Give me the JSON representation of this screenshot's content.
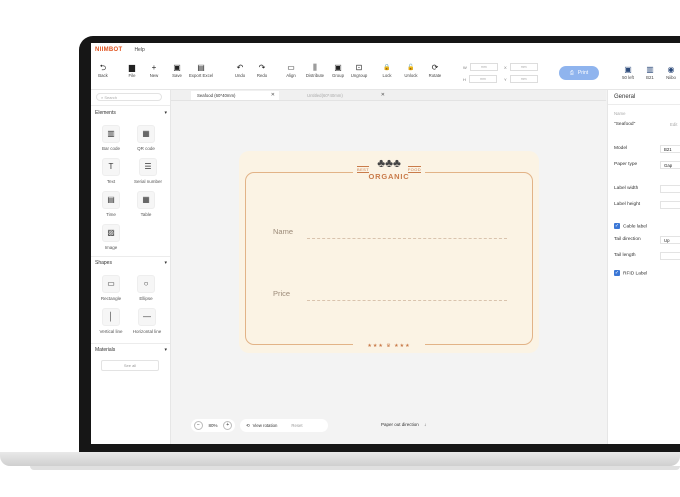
{
  "app": {
    "brand": "NIIMBOT",
    "menu_help": "Help"
  },
  "toolbar": {
    "items": [
      {
        "label": "Back",
        "icon": "back-icon",
        "glyph": "⮌"
      },
      {
        "label": "File",
        "icon": "file-icon",
        "glyph": "▆"
      },
      {
        "label": "New",
        "icon": "plus-icon",
        "glyph": "+"
      },
      {
        "label": "Save",
        "icon": "save-icon",
        "glyph": "▣"
      },
      {
        "label": "Export Excel",
        "icon": "export-excel-icon",
        "glyph": "▤"
      },
      {
        "label": "Undo",
        "icon": "undo-icon",
        "glyph": "↶"
      },
      {
        "label": "Redo",
        "icon": "redo-icon",
        "glyph": "↷"
      },
      {
        "label": "Align",
        "icon": "align-icon",
        "glyph": "▭"
      },
      {
        "label": "Distribute",
        "icon": "distribute-icon",
        "glyph": "⫼"
      },
      {
        "label": "Group",
        "icon": "group-icon",
        "glyph": "▣"
      },
      {
        "label": "Ungroup",
        "icon": "ungroup-icon",
        "glyph": "⊡"
      },
      {
        "label": "Lock",
        "icon": "lock-icon",
        "glyph": "🔒"
      },
      {
        "label": "Unlock",
        "icon": "unlock-icon",
        "glyph": "🔓"
      },
      {
        "label": "Rotate",
        "icon": "rotate-icon",
        "glyph": "⟳"
      }
    ],
    "coords": {
      "w": "W",
      "h": "H",
      "x": "X",
      "y": "Y",
      "w_unit": "mm",
      "h_unit": "mm",
      "x_unit": "mm",
      "y_unit": "mm"
    },
    "print_label": "Print",
    "right_items": [
      {
        "label": "50 left",
        "icon": "label-roll-icon",
        "glyph": "▣"
      },
      {
        "label": "B21",
        "icon": "printer-icon",
        "glyph": "▥"
      },
      {
        "label": "Niibo",
        "icon": "user-icon",
        "glyph": "◉"
      }
    ]
  },
  "left_panel": {
    "search_placeholder": "Search",
    "elements_title": "Elements",
    "elements": [
      {
        "label": "Bar code",
        "icon": "barcode-icon",
        "glyph": "▥"
      },
      {
        "label": "QR code",
        "icon": "qr-code-icon",
        "glyph": "▦"
      },
      {
        "label": "Text",
        "icon": "text-icon",
        "glyph": "T"
      },
      {
        "label": "Serial number",
        "icon": "serial-number-icon",
        "glyph": "☰"
      },
      {
        "label": "Time",
        "icon": "time-icon",
        "glyph": "▤"
      },
      {
        "label": "Table",
        "icon": "table-icon",
        "glyph": "▦"
      },
      {
        "label": "Image",
        "icon": "image-icon",
        "glyph": "▨"
      }
    ],
    "shapes_title": "Shapes",
    "shapes": [
      {
        "label": "Rectangle",
        "icon": "rectangle-icon",
        "glyph": "▭"
      },
      {
        "label": "Ellipse",
        "icon": "ellipse-icon",
        "glyph": "○"
      },
      {
        "label": "Vertical line",
        "icon": "vertical-line-icon",
        "glyph": "│"
      },
      {
        "label": "Horizontal line",
        "icon": "horizontal-line-icon",
        "glyph": "—"
      }
    ],
    "materials_title": "Materials",
    "see_all": "See all"
  },
  "tabs": [
    {
      "label": "Seafood (60*40mm)",
      "active": true
    },
    {
      "label": "Untitled(60*40mm)",
      "active": false
    }
  ],
  "label": {
    "logo_left": "BEST",
    "logo_right": "FOOD",
    "logo_main": "ORGANIC",
    "field_name": "Name",
    "field_price": "Price",
    "stars": "★★★  ♛  ★★★"
  },
  "canvas_controls": {
    "zoom_value": "80%",
    "zoom_minus": "−",
    "zoom_plus": "+",
    "view_rotation": "View rotation",
    "reset": "Reset",
    "paper_out": "Paper out direction",
    "paper_out_arrow": "↓"
  },
  "right_panel": {
    "title": "General",
    "name_label": "Name",
    "name_value": "\"Seafood\"",
    "name_edit": "Edit",
    "model_label": "Model",
    "model_value": "B21",
    "paper_type_label": "Paper type",
    "paper_type_value": "Gap",
    "label_width_label": "Label width",
    "label_width_unit": "mm",
    "label_height_label": "Label height",
    "label_height_unit": "mm",
    "cable_label": "Cable label",
    "tail_direction_label": "Tail direction",
    "tail_direction_value": "Up",
    "tail_length_label": "Tail length",
    "tail_length_unit": "mm",
    "rfid_label": "RFID Label"
  },
  "colors": {
    "accent": "#8fb4ee",
    "brand": "#e0531f",
    "label_bg": "#fbf3e4",
    "label_border": "#e2b387",
    "checkbox": "#3a77d6"
  }
}
